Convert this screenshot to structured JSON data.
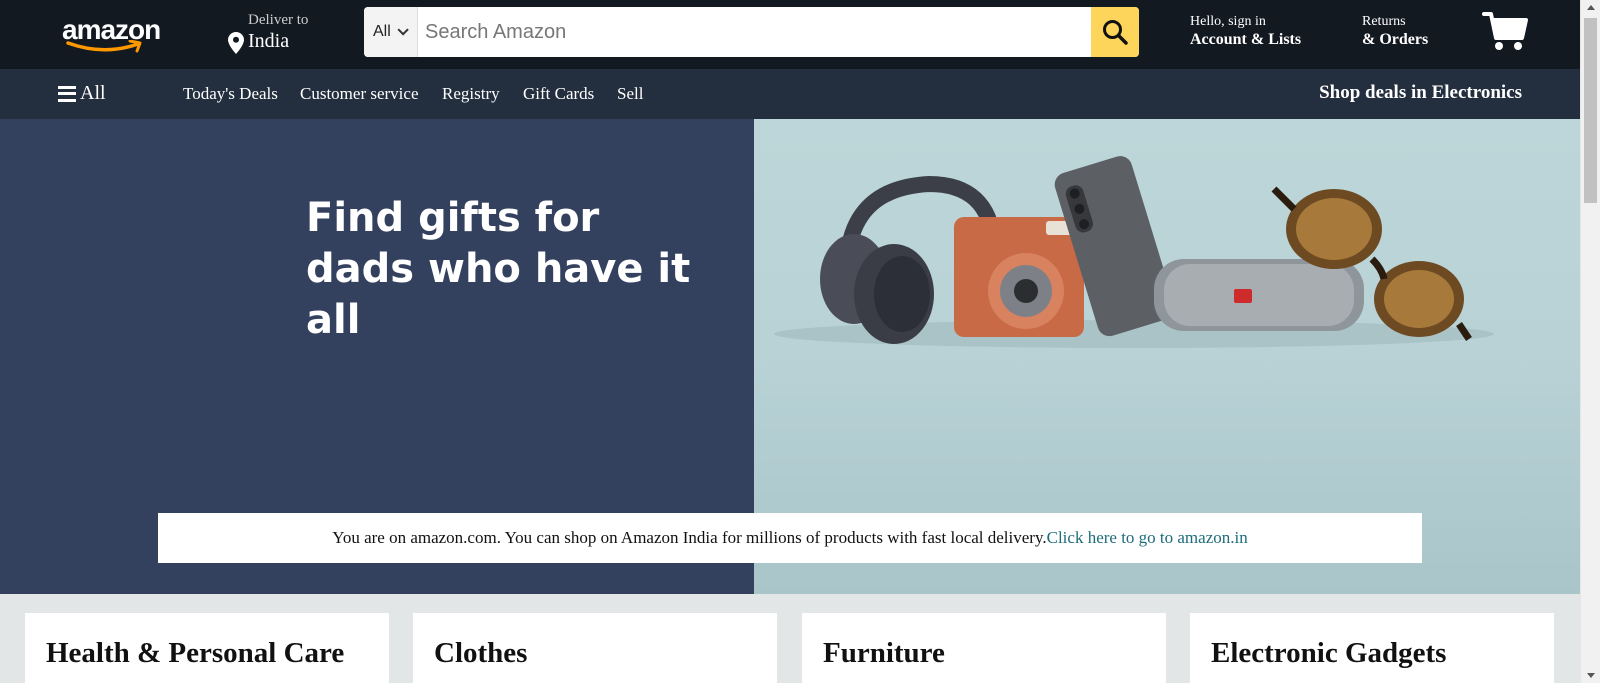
{
  "header": {
    "logo_text": "amazon",
    "deliver_label": "Deliver to",
    "deliver_location": "India",
    "search": {
      "category": "All",
      "placeholder": "Search Amazon",
      "value": ""
    },
    "account_greeting": "Hello, sign in",
    "account_label": "Account & Lists",
    "returns_small": "Returns",
    "returns_big": "& Orders"
  },
  "subnav": {
    "all_label": "All",
    "links": [
      "Today's Deals",
      "Customer service",
      "Registry",
      "Gift Cards",
      "Sell"
    ],
    "promo": "Shop deals in Electronics"
  },
  "hero": {
    "title_line1": "Find gifts for",
    "title_line2": "dads who have it all",
    "notice_text": "You are on amazon.com. You can shop on Amazon India for millions of products with fast local delivery.",
    "notice_link": "Click here to go to amazon.in"
  },
  "cards": [
    {
      "title": "Health & Personal Care"
    },
    {
      "title": "Clothes"
    },
    {
      "title": "Furniture"
    },
    {
      "title": "Electronic Gadgets"
    }
  ],
  "colors": {
    "topbar": "#131921",
    "subnav": "#232f3e",
    "search_button": "#fed55b",
    "hero_left": "#33415f",
    "link": "#1d6c7a"
  },
  "icons": [
    "amazon-smile-icon",
    "location-pin-icon",
    "chevron-down-icon",
    "search-icon",
    "cart-icon",
    "hamburger-icon"
  ]
}
